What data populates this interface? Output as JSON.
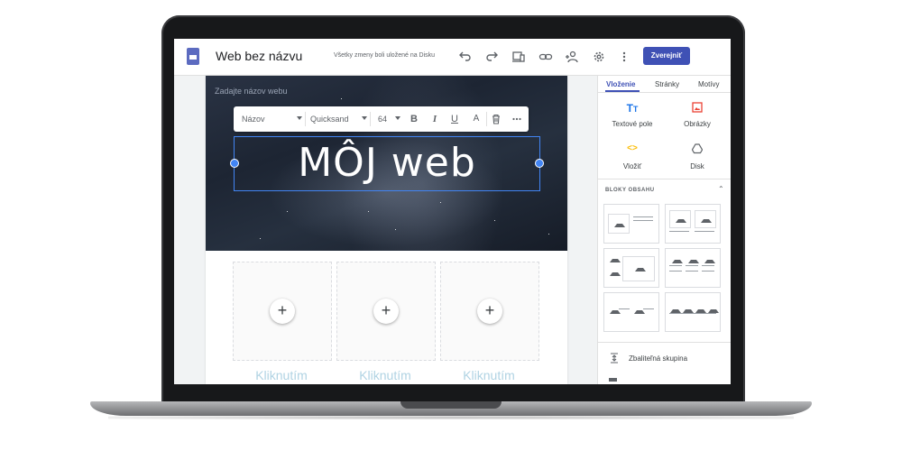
{
  "app": {
    "title": "Web bez názvu",
    "save_status": "Všetky zmeny boli uložené na Disku",
    "publish_label": "Zverejniť",
    "accent_color": "#3f51b5",
    "toolbar_icons": [
      "undo-icon",
      "redo-icon",
      "preview-icon",
      "link-icon",
      "add-person-icon",
      "gear-icon",
      "more-vert-icon"
    ]
  },
  "page": {
    "site_name_placeholder": "Zadajte názov webu",
    "hero_text": "MÔJ web",
    "placeholder_caption": "Kliknutím"
  },
  "format_bar": {
    "style": "Názov",
    "font": "Quicksand",
    "size": "64",
    "buttons": [
      "bold-icon",
      "italic-icon",
      "underline-icon",
      "text-color-icon",
      "delete-icon",
      "more-icon"
    ]
  },
  "panel": {
    "tabs": [
      {
        "label": "Vloženie",
        "active": true
      },
      {
        "label": "Stránky",
        "active": false
      },
      {
        "label": "Motívy",
        "active": false
      }
    ],
    "insert_items": [
      {
        "label": "Textové pole",
        "icon": "text-box-icon"
      },
      {
        "label": "Obrázky",
        "icon": "image-icon"
      },
      {
        "label": "Vložiť",
        "icon": "embed-icon"
      },
      {
        "label": "Disk",
        "icon": "drive-icon"
      }
    ],
    "blocks_heading": "BLOKY OBSAHU",
    "collapsible_group": "Zbaliteľná skupina"
  }
}
